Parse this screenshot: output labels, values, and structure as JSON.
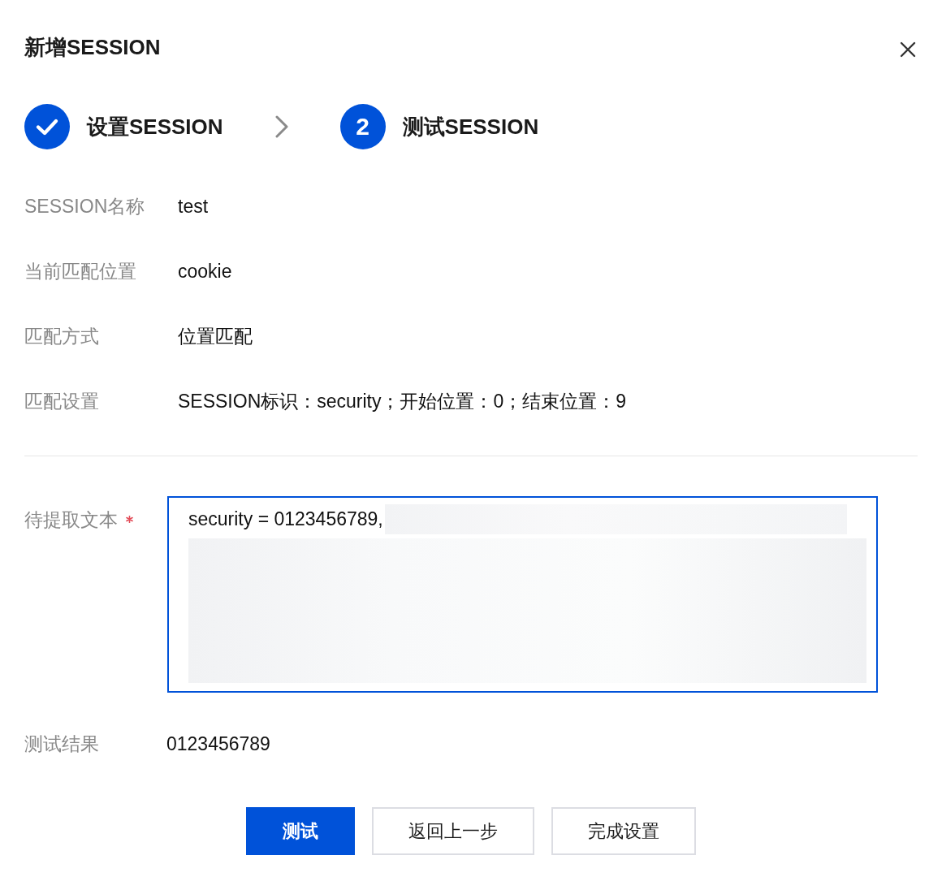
{
  "dialog": {
    "title": "新增SESSION"
  },
  "steps": [
    {
      "label": "设置SESSION",
      "completed": true
    },
    {
      "label": "测试SESSION",
      "number": "2",
      "completed": false
    }
  ],
  "fields": [
    {
      "label": "SESSION名称",
      "value": "test"
    },
    {
      "label": "当前匹配位置",
      "value": "cookie"
    },
    {
      "label": "匹配方式",
      "value": "位置匹配"
    },
    {
      "label": "匹配设置",
      "value": "SESSION标识：security；开始位置：0；结束位置：9"
    }
  ],
  "text_input": {
    "label": "待提取文本",
    "required": true,
    "focused": true,
    "redacted": true,
    "value": "security = 0123456789,"
  },
  "result": {
    "label": "测试结果",
    "value": "0123456789"
  },
  "buttons": [
    {
      "label": "测试",
      "primary": true
    },
    {
      "label": "返回上一步",
      "primary": false
    },
    {
      "label": "完成设置",
      "primary": false
    }
  ]
}
